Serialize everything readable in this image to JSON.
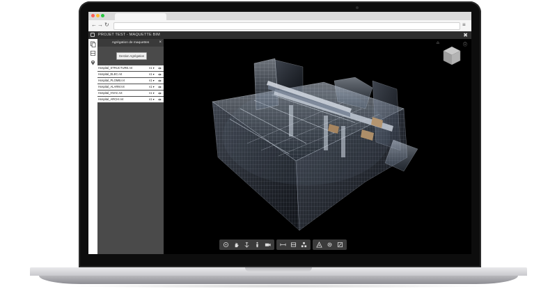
{
  "app": {
    "title": "PROJET TEST - MAQUETTE BIM"
  },
  "browser": {
    "url": "",
    "nav": {
      "back": "←",
      "forward": "→",
      "reload": "↻"
    },
    "menu_icon": "hamburger-menu-icon"
  },
  "panel": {
    "title": "Agrégation de maquettes",
    "close": "×",
    "manage_button": "Gestion Agrégation",
    "models": [
      {
        "name": "Hospital_STRUCTURE.rvt",
        "version": "v1 ▾"
      },
      {
        "name": "Hospital_ELEC.rvt",
        "version": "v1 ▾"
      },
      {
        "name": "Hospital_PLOMB.rvt",
        "version": "v1 ▾"
      },
      {
        "name": "Hospital_ALARM.rvt",
        "version": "v1 ▾"
      },
      {
        "name": "Hospital_HVAC.rvt",
        "version": "v1 ▾"
      },
      {
        "name": "Hospital_ARCHI.rvt",
        "version": "v1 ▾"
      }
    ]
  },
  "viewer": {
    "top_icons": [
      "home-icon",
      "info-icon"
    ],
    "toolbar_groups": [
      [
        "orbit-icon",
        "pan-icon",
        "zoom-icon",
        "first-person-icon",
        "camera-icon"
      ],
      [
        "measure-icon",
        "section-icon",
        "explode-icon"
      ],
      [
        "model-browser-icon",
        "settings-icon",
        "fullscreen-icon"
      ]
    ]
  },
  "colors": {
    "app_header": "#2e2e2e",
    "panel_bg": "#4a4a4a",
    "viewer_bg": "#000000",
    "toolbar_bg": "#3b3b3b"
  }
}
